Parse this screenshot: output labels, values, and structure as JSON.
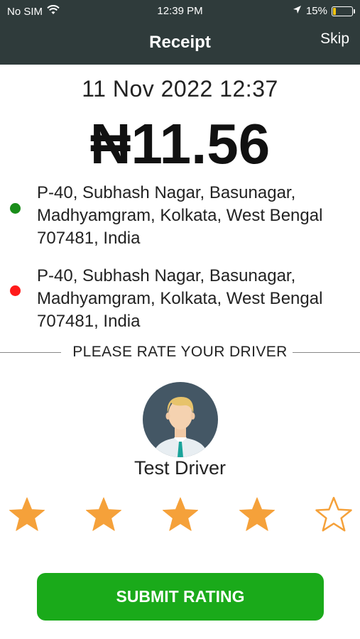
{
  "status_bar": {
    "carrier": "No SIM",
    "time": "12:39 PM",
    "battery": "15%",
    "battery_level": 0.15
  },
  "header": {
    "title": "Receipt",
    "skip_label": "Skip"
  },
  "receipt": {
    "datetime": "11 Nov 2022 12:37",
    "amount": "₦11.56",
    "pickup_address": "P-40, Subhash Nagar, Basunagar, Madhyamgram, Kolkata, West Bengal 707481, India",
    "dropoff_address": "P-40, Subhash Nagar, Basunagar, Madhyamgram, Kolkata, West Bengal 707481, India"
  },
  "rating": {
    "prompt": "PLEASE RATE YOUR DRIVER",
    "driver_name": "Test Driver",
    "value": 4,
    "max": 5,
    "submit_label": "SUBMIT RATING"
  },
  "colors": {
    "header_bg": "#2f3b3b",
    "star": "#f5a13a",
    "submit_bg": "#1aaa1a",
    "pickup_dot": "#1a8d1a",
    "dropoff_dot": "#ff1a1a"
  },
  "icons": [
    "wifi-icon",
    "location-arrow-icon",
    "battery-icon",
    "user-avatar-icon",
    "star-icon"
  ]
}
